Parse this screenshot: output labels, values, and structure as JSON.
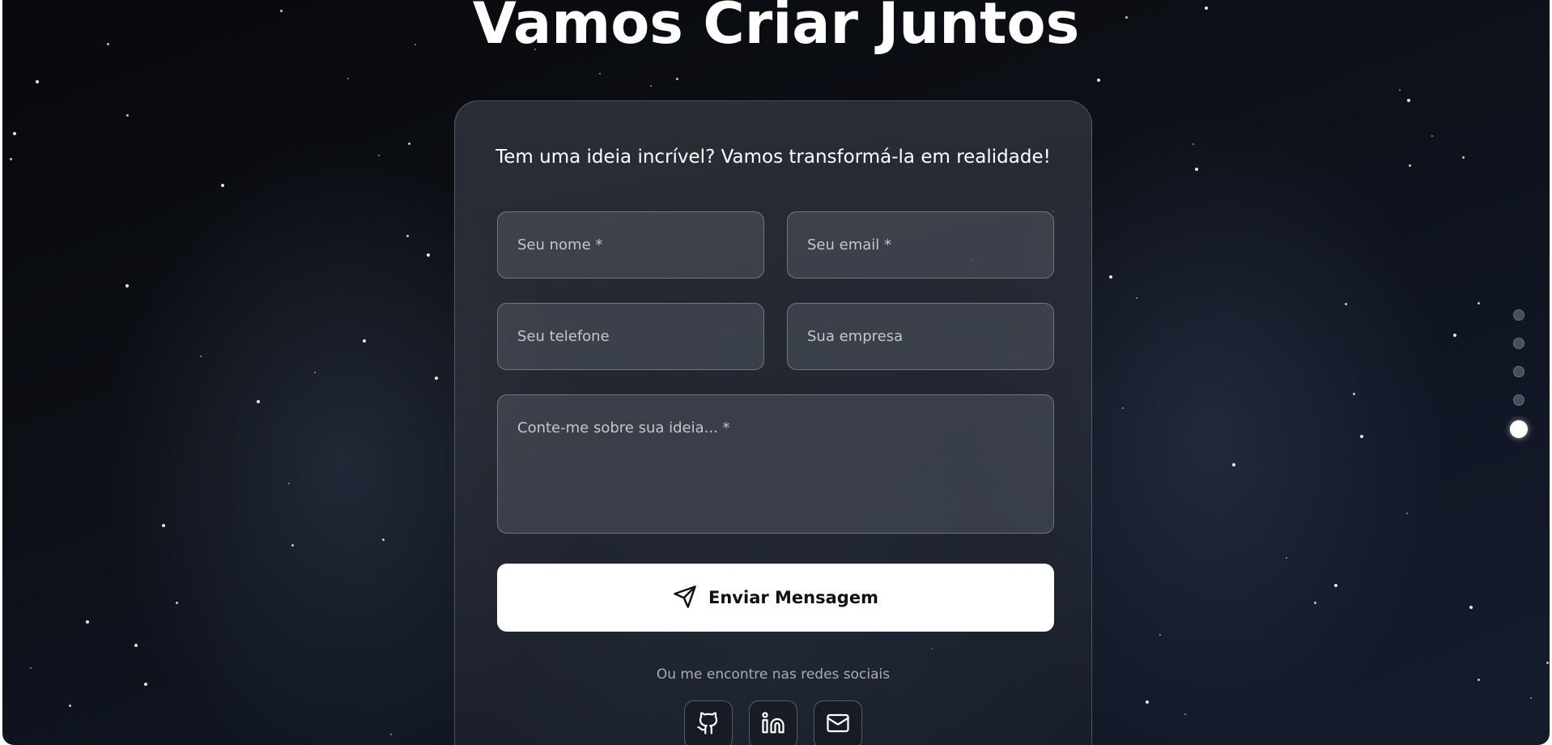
{
  "hero": {
    "title": "Vamos Criar Juntos"
  },
  "contact_form": {
    "subtitle": "Tem uma ideia incrível? Vamos transformá-la em realidade!",
    "name_placeholder": "Seu nome *",
    "email_placeholder": "Seu email *",
    "phone_placeholder": "Seu telefone",
    "company_placeholder": "Sua empresa",
    "message_placeholder": "Conte-me sobre sua ideia... *",
    "submit_label": "Enviar Mensagem",
    "submit_icon": "send-icon"
  },
  "social": {
    "caption": "Ou me encontre nas redes sociais",
    "links": [
      {
        "icon": "github-icon"
      },
      {
        "icon": "linkedin-icon"
      },
      {
        "icon": "mail-icon"
      }
    ]
  },
  "section_nav": {
    "count": 5,
    "active_index": 4
  },
  "colors": {
    "background": "#0c0f15",
    "accent": "#ffffff",
    "card_border": "rgba(255,255,255,0.22)",
    "muted_text": "#a8abb2"
  }
}
